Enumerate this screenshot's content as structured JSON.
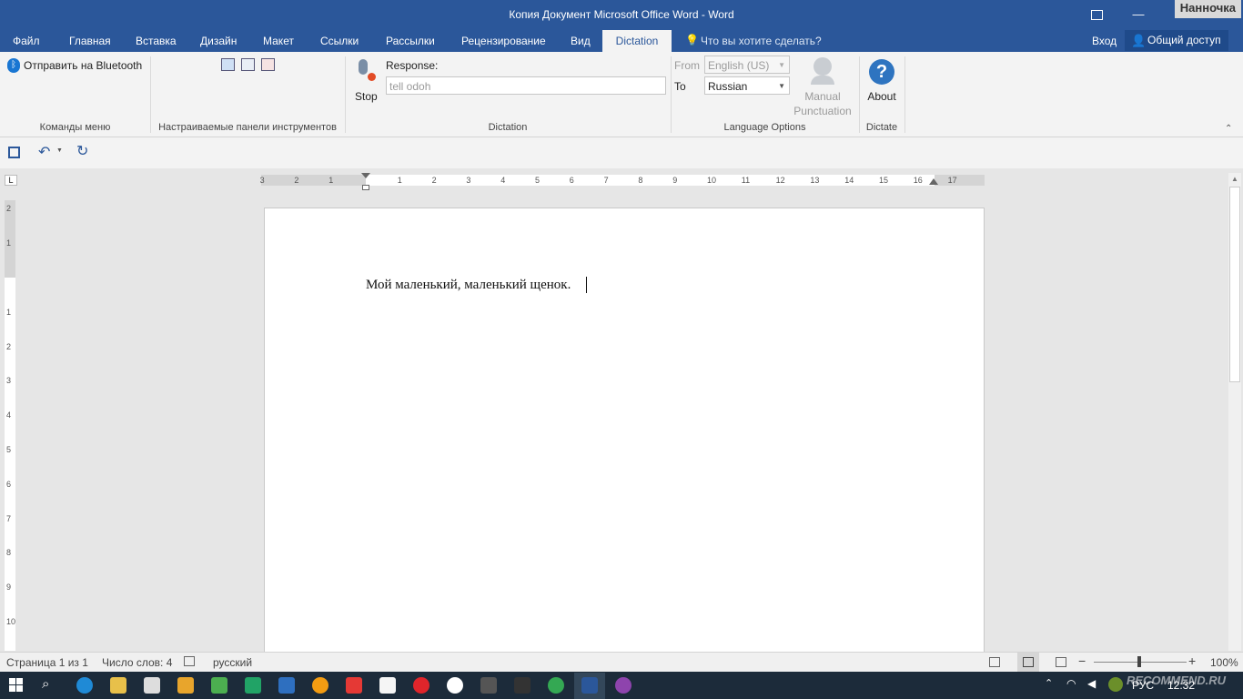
{
  "titlebar": {
    "title": "Копия Документ Microsoft Office Word - Word",
    "user_name": "Нанночка",
    "restore_icon": "ribbon-display-icon",
    "minimize_glyph": "—",
    "maximize_glyph": "☐",
    "close_glyph": "✕"
  },
  "tabs": [
    {
      "label": "Файл"
    },
    {
      "label": "Главная"
    },
    {
      "label": "Вставка"
    },
    {
      "label": "Дизайн"
    },
    {
      "label": "Макет"
    },
    {
      "label": "Ссылки"
    },
    {
      "label": "Рассылки"
    },
    {
      "label": "Рецензирование"
    },
    {
      "label": "Вид"
    },
    {
      "label": "Dictation"
    }
  ],
  "tell_me": "Что вы хотите сделать?",
  "signin": "Вход",
  "share": "Общий доступ",
  "ribbon": {
    "bluetooth_label": "Отправить на Bluetooth",
    "group_menu_commands": "Команды меню",
    "group_custom_toolbars": "Настраиваемые панели инструментов",
    "stop_label": "Stop",
    "response_label": "Response:",
    "response_value": "tell odoh",
    "group_dictation": "Dictation",
    "from_label": "From",
    "from_value": "English (US)",
    "to_label": "To",
    "to_value": "Russian",
    "manual_label": "Manual",
    "punctuation_label": "Punctuation",
    "group_language": "Language Options",
    "about_label": "About",
    "group_dictate": "Dictate"
  },
  "ruler": {
    "h_labels": [
      "3",
      "2",
      "1",
      "1",
      "2",
      "3",
      "4",
      "5",
      "6",
      "7",
      "8",
      "9",
      "10",
      "11",
      "12",
      "13",
      "14",
      "15",
      "16",
      "17"
    ],
    "v_labels": [
      "2",
      "1",
      "1",
      "2",
      "3",
      "4",
      "5",
      "6",
      "7",
      "8",
      "9",
      "10"
    ]
  },
  "document": {
    "text": "Мой маленький, маленький щенок."
  },
  "status": {
    "page": "Страница 1 из 1",
    "words": "Число слов: 4",
    "language": "русский",
    "zoom": "100%"
  },
  "taskbar": {
    "language": "РУС",
    "time": "12:32",
    "watermark": "RECOMMEND.RU"
  },
  "colors": {
    "word_blue": "#2b579a",
    "ribbon_bg": "#f3f3f3",
    "taskbar_bg": "#1c2b3a"
  }
}
